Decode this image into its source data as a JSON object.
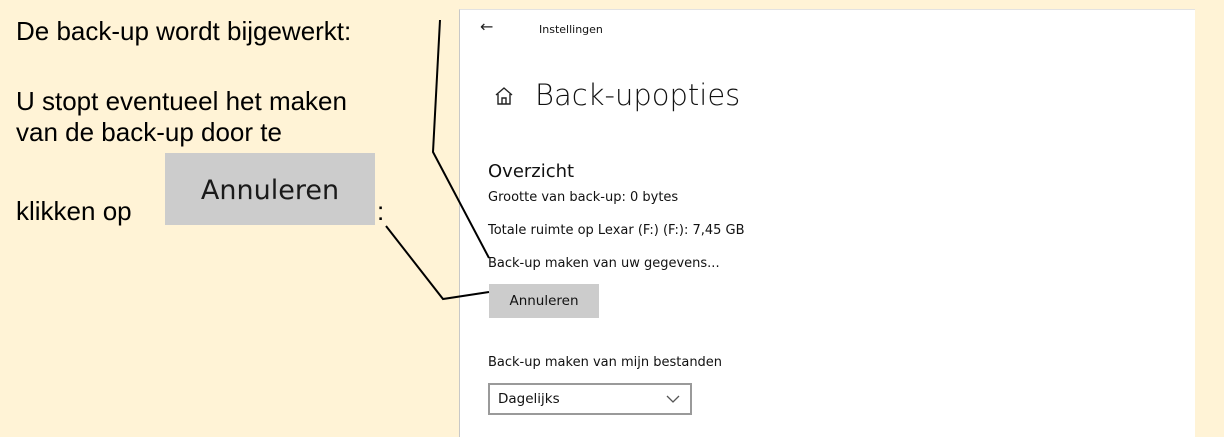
{
  "tutorial": {
    "line1": "De back-up wordt bijgewerkt:",
    "line2": "U stopt eventueel het maken",
    "line3": "van de back-up door te",
    "line4_prefix": "klikken op",
    "line4_suffix": ":",
    "cancel_image_label": "Annuleren"
  },
  "window": {
    "back_icon": "back-arrow-icon",
    "breadcrumb": "Instellingen",
    "title_icon": "home-icon",
    "title": "Back-upopties"
  },
  "overview": {
    "heading": "Overzicht",
    "backup_size": "Grootte van back-up: 0 bytes",
    "total_space": "Totale ruimte op Lexar (F:) (F:): 7,45 GB",
    "status": "Back-up maken van uw gegevens...",
    "cancel_label": "Annuleren"
  },
  "schedule": {
    "label": "Back-up maken van mijn bestanden",
    "selected": "Dagelijks",
    "dropdown_icon": "chevron-down-icon"
  },
  "colors": {
    "page_background": "#fff3d6",
    "panel_background": "#ffffff",
    "button_gray": "#cccccc",
    "pointer_line": "#000000"
  }
}
